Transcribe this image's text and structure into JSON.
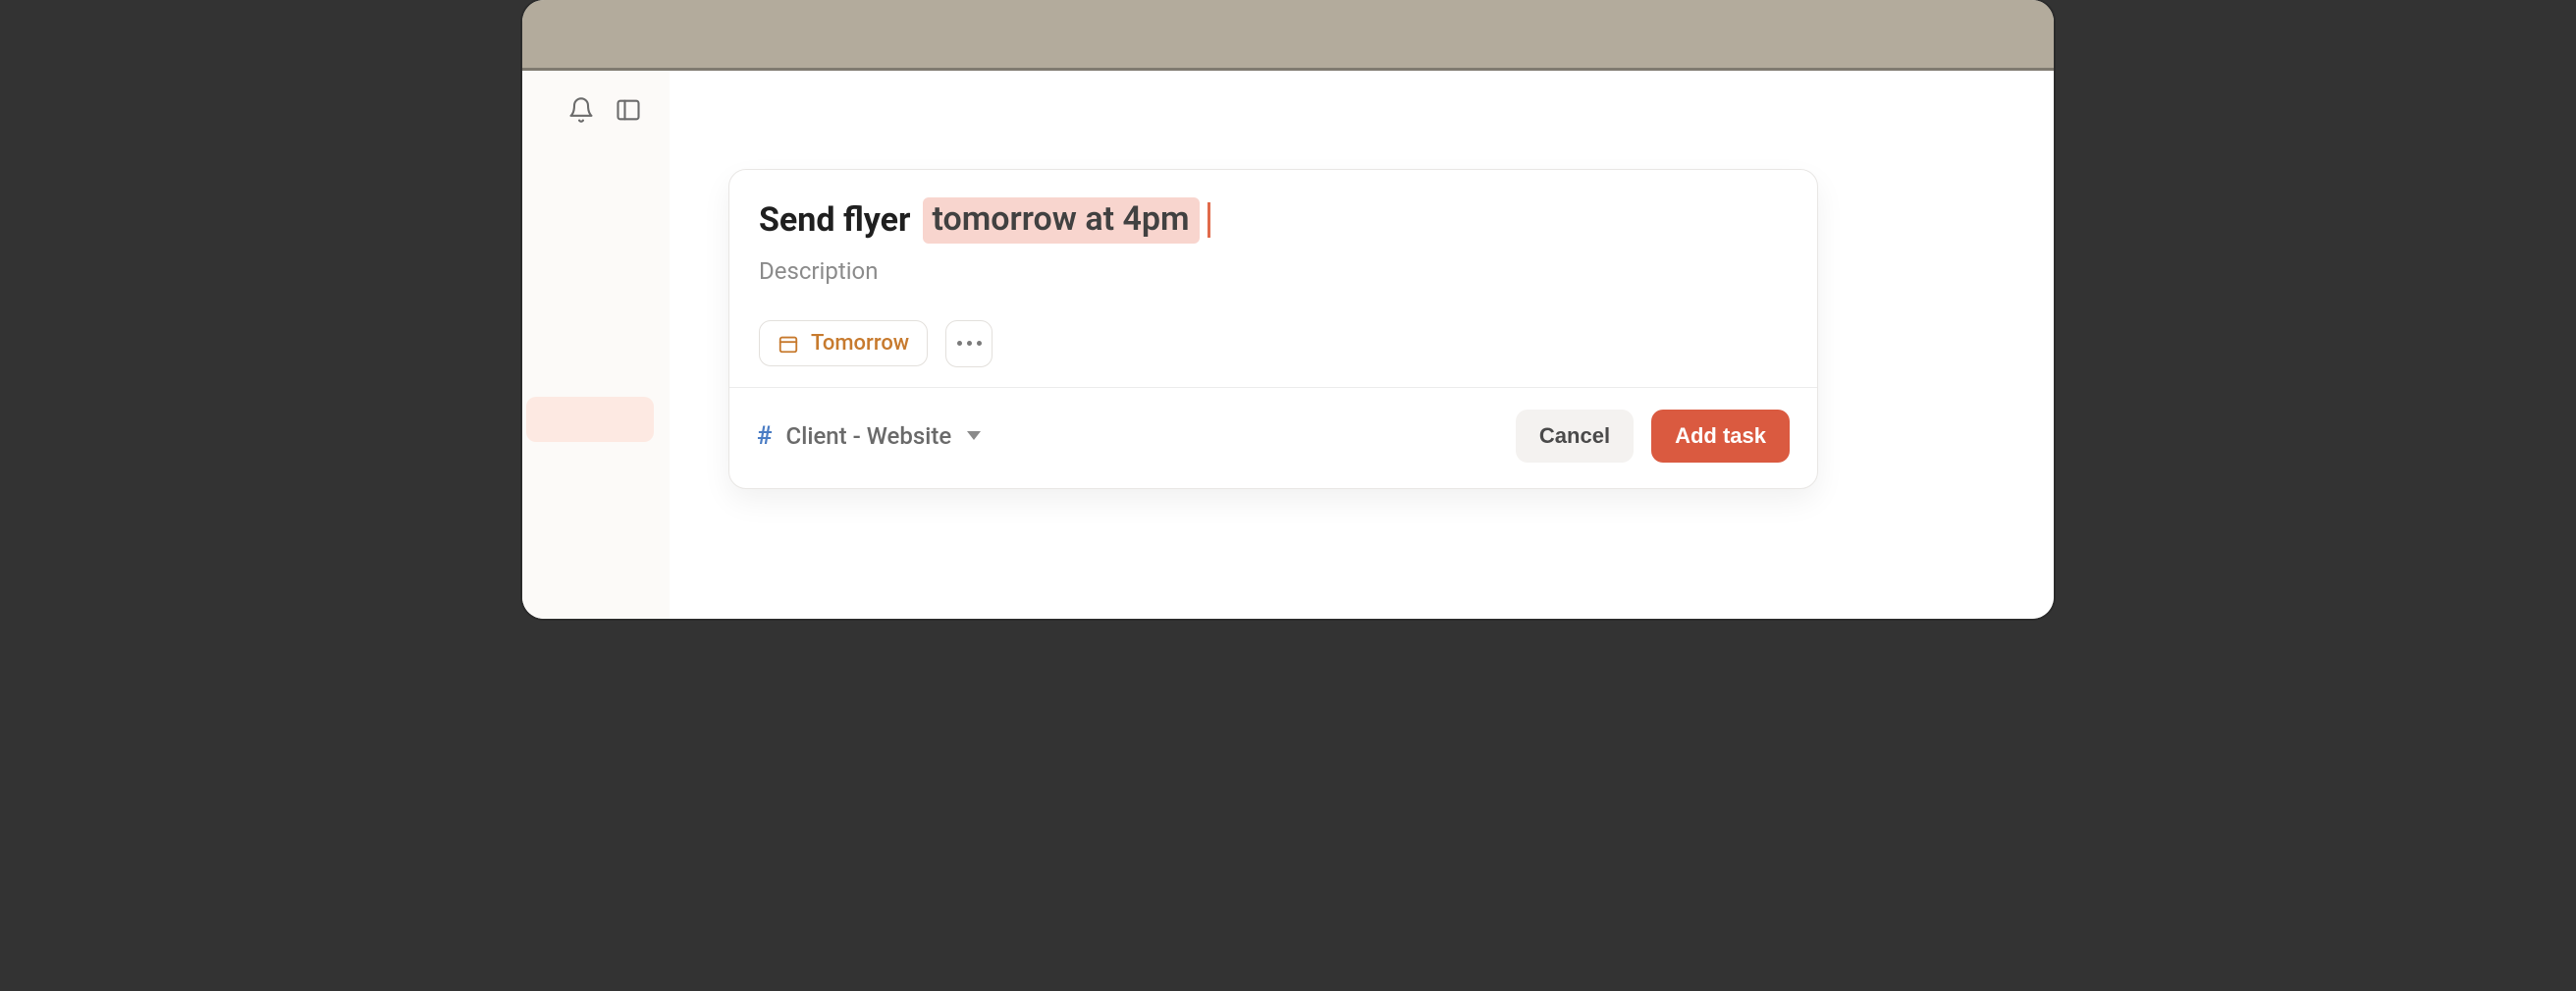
{
  "task": {
    "title_text": "Send flyer",
    "title_highlight": "tomorrow at 4pm",
    "description_placeholder": "Description"
  },
  "chips": {
    "due_label": "Tomorrow"
  },
  "project": {
    "name": "Client - Website"
  },
  "actions": {
    "cancel": "Cancel",
    "add": "Add task"
  }
}
